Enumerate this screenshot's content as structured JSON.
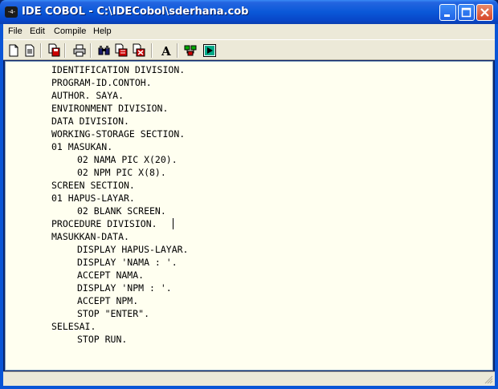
{
  "window": {
    "title": "IDE COBOL - C:\\IDECobol\\sderhana.cob",
    "app_icon_text": "-4-"
  },
  "menu": {
    "file": "File",
    "edit": "Edit",
    "compile": "Compile",
    "help": "Help"
  },
  "toolbar": {
    "icons": [
      "new-file-icon",
      "open-file-icon",
      "save-icon",
      "print-icon",
      "find-icon",
      "replace-icon",
      "delete-icon",
      "font-icon",
      "compile-icon",
      "run-icon"
    ]
  },
  "editor": {
    "lines": [
      {
        "text": "IDENTIFICATION DIVISION.",
        "indent": 0
      },
      {
        "text": "PROGRAM-ID.CONTOH.",
        "indent": 0
      },
      {
        "text": "AUTHOR. SAYA.",
        "indent": 0
      },
      {
        "text": "ENVIRONMENT DIVISION.",
        "indent": 0
      },
      {
        "text": "DATA DIVISION.",
        "indent": 0
      },
      {
        "text": "WORKING-STORAGE SECTION.",
        "indent": 0
      },
      {
        "text": "01 MASUKAN.",
        "indent": 0
      },
      {
        "text": "02 NAMA PIC X(20).",
        "indent": 1
      },
      {
        "text": "02 NPM PIC X(8).",
        "indent": 1
      },
      {
        "text": "SCREEN SECTION.",
        "indent": 0
      },
      {
        "text": "01 HAPUS-LAYAR.",
        "indent": 0
      },
      {
        "text": "02 BLANK SCREEN.",
        "indent": 1
      },
      {
        "text": "PROCEDURE DIVISION.",
        "indent": 0
      },
      {
        "text": "MASUKKAN-DATA.",
        "indent": 0
      },
      {
        "text": "DISPLAY HAPUS-LAYAR.",
        "indent": 1
      },
      {
        "text": "DISPLAY 'NAMA : '.",
        "indent": 1
      },
      {
        "text": "ACCEPT NAMA.",
        "indent": 1
      },
      {
        "text": "DISPLAY 'NPM : '.",
        "indent": 1
      },
      {
        "text": "ACCEPT NPM.",
        "indent": 1
      },
      {
        "text": "STOP \"ENTER\".",
        "indent": 1
      },
      {
        "text": "SELESAI.",
        "indent": 0
      },
      {
        "text": "STOP RUN.",
        "indent": 1
      }
    ]
  },
  "colors": {
    "editor_bg": "#fffff0",
    "title_blue": "#0a58d8",
    "chrome": "#ece9d8"
  }
}
